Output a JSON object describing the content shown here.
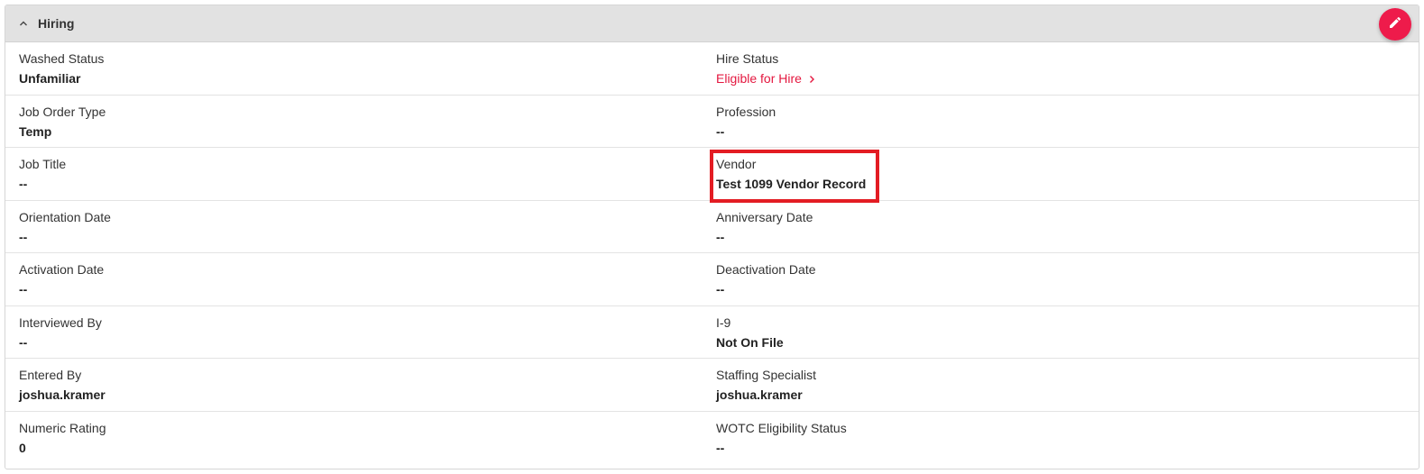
{
  "section": {
    "title": "Hiring",
    "collapse_icon": "chevron-up-icon",
    "edit_icon": "pencil-icon",
    "accent_color": "#ee1b4b"
  },
  "fields": {
    "washed_status": {
      "label": "Washed Status",
      "value": "Unfamiliar"
    },
    "hire_status": {
      "label": "Hire Status",
      "value": "Eligible for Hire"
    },
    "job_order_type": {
      "label": "Job Order Type",
      "value": "Temp"
    },
    "profession": {
      "label": "Profession",
      "value": "--"
    },
    "job_title": {
      "label": "Job Title",
      "value": "--"
    },
    "vendor": {
      "label": "Vendor",
      "value": "Test 1099 Vendor Record"
    },
    "orientation_date": {
      "label": "Orientation Date",
      "value": "--"
    },
    "anniversary_date": {
      "label": "Anniversary Date",
      "value": "--"
    },
    "activation_date": {
      "label": "Activation Date",
      "value": "--"
    },
    "deactivation_date": {
      "label": "Deactivation Date",
      "value": "--"
    },
    "interviewed_by": {
      "label": "Interviewed By",
      "value": "--"
    },
    "i9": {
      "label": "I-9",
      "value": "Not On File"
    },
    "entered_by": {
      "label": "Entered By",
      "value": "joshua.kramer"
    },
    "staffing_specialist": {
      "label": "Staffing Specialist",
      "value": "joshua.kramer"
    },
    "numeric_rating": {
      "label": "Numeric Rating",
      "value": "0"
    },
    "wotc_eligibility_status": {
      "label": "WOTC Eligibility Status",
      "value": "--"
    }
  }
}
